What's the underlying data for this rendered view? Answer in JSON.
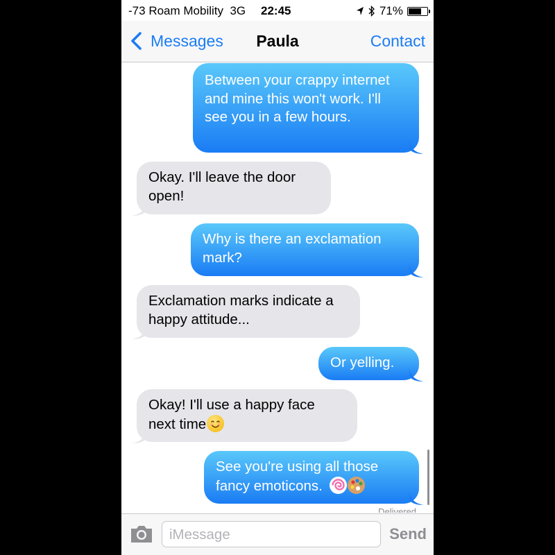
{
  "status_bar": {
    "signal": "-73",
    "carrier": "Roam Mobility",
    "network": "3G",
    "time": "22:45",
    "battery_percent_text": "71%",
    "battery_level": 0.71,
    "icons": [
      "location-arrow-icon",
      "bluetooth-icon",
      "battery-icon"
    ]
  },
  "nav": {
    "back_label": "Messages",
    "title": "Paula",
    "contact_label": "Contact"
  },
  "messages": [
    {
      "direction": "outgoing",
      "text": "Between your crappy internet and mine this won't work. I'll see you in a few hours."
    },
    {
      "direction": "incoming",
      "text": "Okay. I'll leave the door open!"
    },
    {
      "direction": "outgoing",
      "text": "Why is there an exclamation mark?"
    },
    {
      "direction": "incoming",
      "text": "Exclamation marks indicate a happy attitude..."
    },
    {
      "direction": "outgoing",
      "text": "Or yelling."
    },
    {
      "direction": "incoming",
      "text": "Okay!  I'll use a happy face next time",
      "emoji": [
        "smiling-face-emoji"
      ]
    },
    {
      "direction": "outgoing",
      "text": "See you're  using all those fancy emoticons.",
      "emoji": [
        "lollipop-emoji",
        "artist-palette-emoji"
      ]
    }
  ],
  "delivered_label": "Delivered",
  "input": {
    "placeholder": "iMessage",
    "send_label": "Send"
  },
  "colors": {
    "accent": "#1a7cf4",
    "outgoing_top": "#5ac8fa",
    "outgoing_bottom": "#1a7cf4",
    "incoming": "#e5e5ea"
  }
}
